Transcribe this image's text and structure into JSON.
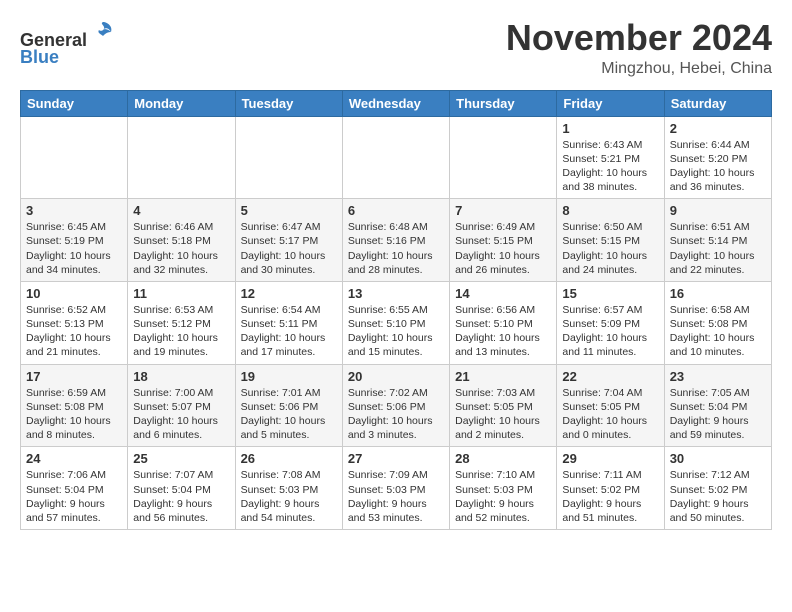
{
  "header": {
    "logo_line1": "General",
    "logo_line2": "Blue",
    "month_title": "November 2024",
    "location": "Mingzhou, Hebei, China"
  },
  "days_of_week": [
    "Sunday",
    "Monday",
    "Tuesday",
    "Wednesday",
    "Thursday",
    "Friday",
    "Saturday"
  ],
  "weeks": [
    [
      {
        "day": "",
        "info": ""
      },
      {
        "day": "",
        "info": ""
      },
      {
        "day": "",
        "info": ""
      },
      {
        "day": "",
        "info": ""
      },
      {
        "day": "",
        "info": ""
      },
      {
        "day": "1",
        "info": "Sunrise: 6:43 AM\nSunset: 5:21 PM\nDaylight: 10 hours\nand 38 minutes."
      },
      {
        "day": "2",
        "info": "Sunrise: 6:44 AM\nSunset: 5:20 PM\nDaylight: 10 hours\nand 36 minutes."
      }
    ],
    [
      {
        "day": "3",
        "info": "Sunrise: 6:45 AM\nSunset: 5:19 PM\nDaylight: 10 hours\nand 34 minutes."
      },
      {
        "day": "4",
        "info": "Sunrise: 6:46 AM\nSunset: 5:18 PM\nDaylight: 10 hours\nand 32 minutes."
      },
      {
        "day": "5",
        "info": "Sunrise: 6:47 AM\nSunset: 5:17 PM\nDaylight: 10 hours\nand 30 minutes."
      },
      {
        "day": "6",
        "info": "Sunrise: 6:48 AM\nSunset: 5:16 PM\nDaylight: 10 hours\nand 28 minutes."
      },
      {
        "day": "7",
        "info": "Sunrise: 6:49 AM\nSunset: 5:15 PM\nDaylight: 10 hours\nand 26 minutes."
      },
      {
        "day": "8",
        "info": "Sunrise: 6:50 AM\nSunset: 5:15 PM\nDaylight: 10 hours\nand 24 minutes."
      },
      {
        "day": "9",
        "info": "Sunrise: 6:51 AM\nSunset: 5:14 PM\nDaylight: 10 hours\nand 22 minutes."
      }
    ],
    [
      {
        "day": "10",
        "info": "Sunrise: 6:52 AM\nSunset: 5:13 PM\nDaylight: 10 hours\nand 21 minutes."
      },
      {
        "day": "11",
        "info": "Sunrise: 6:53 AM\nSunset: 5:12 PM\nDaylight: 10 hours\nand 19 minutes."
      },
      {
        "day": "12",
        "info": "Sunrise: 6:54 AM\nSunset: 5:11 PM\nDaylight: 10 hours\nand 17 minutes."
      },
      {
        "day": "13",
        "info": "Sunrise: 6:55 AM\nSunset: 5:10 PM\nDaylight: 10 hours\nand 15 minutes."
      },
      {
        "day": "14",
        "info": "Sunrise: 6:56 AM\nSunset: 5:10 PM\nDaylight: 10 hours\nand 13 minutes."
      },
      {
        "day": "15",
        "info": "Sunrise: 6:57 AM\nSunset: 5:09 PM\nDaylight: 10 hours\nand 11 minutes."
      },
      {
        "day": "16",
        "info": "Sunrise: 6:58 AM\nSunset: 5:08 PM\nDaylight: 10 hours\nand 10 minutes."
      }
    ],
    [
      {
        "day": "17",
        "info": "Sunrise: 6:59 AM\nSunset: 5:08 PM\nDaylight: 10 hours\nand 8 minutes."
      },
      {
        "day": "18",
        "info": "Sunrise: 7:00 AM\nSunset: 5:07 PM\nDaylight: 10 hours\nand 6 minutes."
      },
      {
        "day": "19",
        "info": "Sunrise: 7:01 AM\nSunset: 5:06 PM\nDaylight: 10 hours\nand 5 minutes."
      },
      {
        "day": "20",
        "info": "Sunrise: 7:02 AM\nSunset: 5:06 PM\nDaylight: 10 hours\nand 3 minutes."
      },
      {
        "day": "21",
        "info": "Sunrise: 7:03 AM\nSunset: 5:05 PM\nDaylight: 10 hours\nand 2 minutes."
      },
      {
        "day": "22",
        "info": "Sunrise: 7:04 AM\nSunset: 5:05 PM\nDaylight: 10 hours\nand 0 minutes."
      },
      {
        "day": "23",
        "info": "Sunrise: 7:05 AM\nSunset: 5:04 PM\nDaylight: 9 hours\nand 59 minutes."
      }
    ],
    [
      {
        "day": "24",
        "info": "Sunrise: 7:06 AM\nSunset: 5:04 PM\nDaylight: 9 hours\nand 57 minutes."
      },
      {
        "day": "25",
        "info": "Sunrise: 7:07 AM\nSunset: 5:04 PM\nDaylight: 9 hours\nand 56 minutes."
      },
      {
        "day": "26",
        "info": "Sunrise: 7:08 AM\nSunset: 5:03 PM\nDaylight: 9 hours\nand 54 minutes."
      },
      {
        "day": "27",
        "info": "Sunrise: 7:09 AM\nSunset: 5:03 PM\nDaylight: 9 hours\nand 53 minutes."
      },
      {
        "day": "28",
        "info": "Sunrise: 7:10 AM\nSunset: 5:03 PM\nDaylight: 9 hours\nand 52 minutes."
      },
      {
        "day": "29",
        "info": "Sunrise: 7:11 AM\nSunset: 5:02 PM\nDaylight: 9 hours\nand 51 minutes."
      },
      {
        "day": "30",
        "info": "Sunrise: 7:12 AM\nSunset: 5:02 PM\nDaylight: 9 hours\nand 50 minutes."
      }
    ]
  ]
}
